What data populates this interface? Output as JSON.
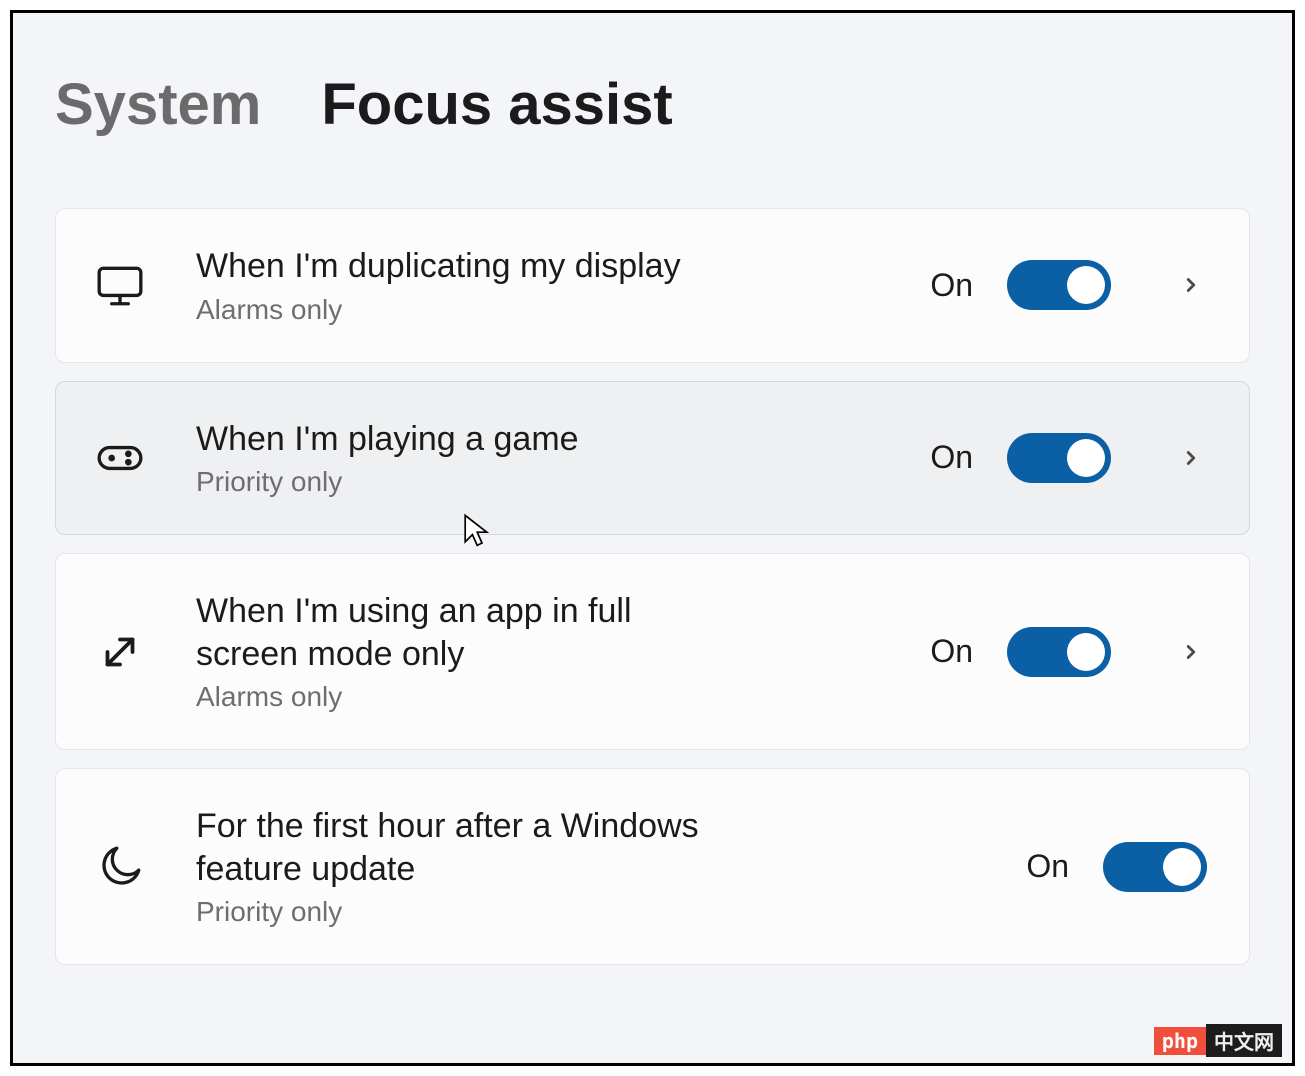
{
  "breadcrumb": {
    "parent": "System",
    "current": "Focus assist"
  },
  "rows": [
    {
      "icon": "monitor-icon",
      "title": "When I'm duplicating my display",
      "subtitle": "Alarms only",
      "state": "On",
      "toggle_on": true,
      "expandable": true,
      "hover": false
    },
    {
      "icon": "gamepad-icon",
      "title": "When I'm playing a game",
      "subtitle": "Priority only",
      "state": "On",
      "toggle_on": true,
      "expandable": true,
      "hover": true
    },
    {
      "icon": "fullscreen-icon",
      "title": "When I'm using an app in full screen mode only",
      "subtitle": "Alarms only",
      "state": "On",
      "toggle_on": true,
      "expandable": true,
      "hover": false
    },
    {
      "icon": "moon-icon",
      "title": "For the first hour after a Windows feature update",
      "subtitle": "Priority only",
      "state": "On",
      "toggle_on": true,
      "expandable": false,
      "hover": false
    }
  ],
  "colors": {
    "accent": "#0b5fa4",
    "page_bg": "#f3f5f9",
    "card_bg": "#fcfcfd",
    "card_hover_bg": "#eff0f2"
  },
  "watermark": {
    "left": "php",
    "right": "中文网"
  }
}
